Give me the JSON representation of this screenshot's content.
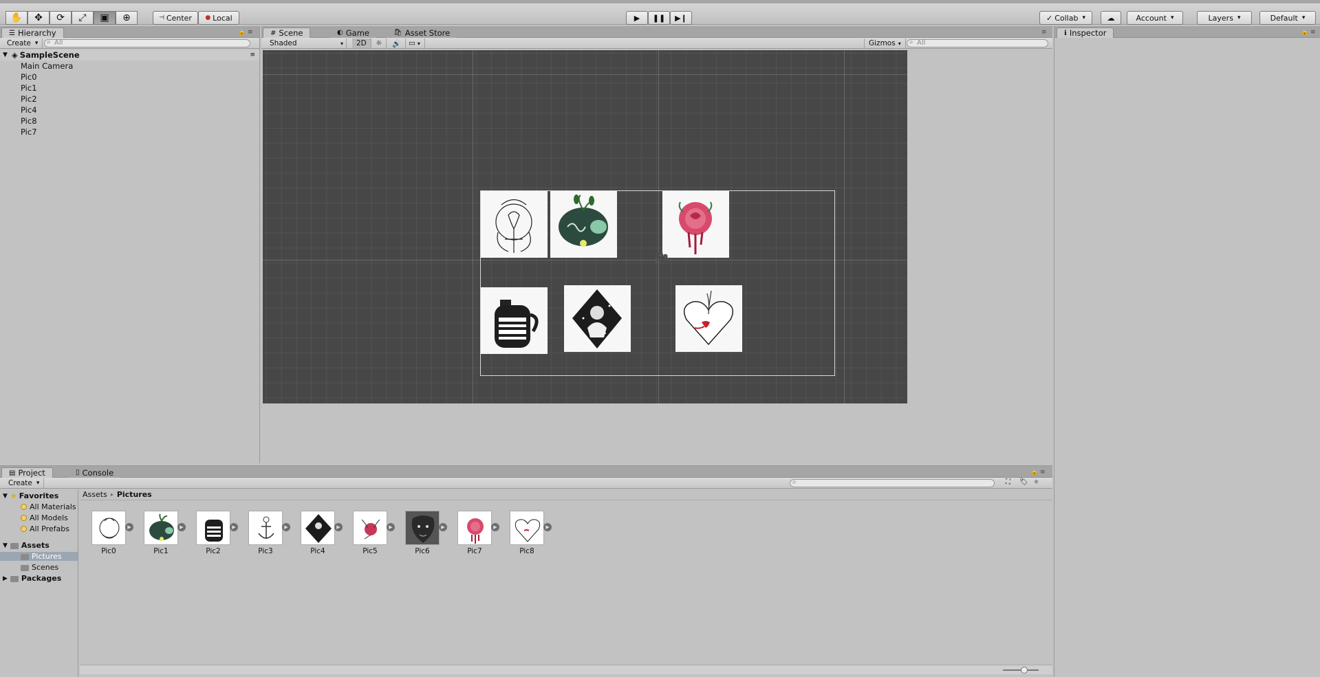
{
  "toolbar": {
    "tools": [
      "hand-tool-icon",
      "move-tool-icon",
      "rotate-tool-icon",
      "scale-tool-icon",
      "rect-tool-icon",
      "transform-tool-icon"
    ],
    "pivot_mode": "Center",
    "pivot_rotation": "Local",
    "collab": "Collab",
    "account": "Account",
    "layers": "Layers",
    "layout": "Default"
  },
  "hierarchy": {
    "tab": "Hierarchy",
    "create": "Create",
    "search_placeholder": "All",
    "scene": "SampleScene",
    "items": [
      "Main Camera",
      "Pic0",
      "Pic1",
      "Pic2",
      "Pic4",
      "Pic8",
      "Pic7"
    ]
  },
  "scene_tabs": {
    "scene": "Scene",
    "game": "Game",
    "asset_store": "Asset Store"
  },
  "scene_toolbar": {
    "shading": "Shaded",
    "mode_2d": "2D",
    "gizmos": "Gizmos",
    "search_placeholder": "All"
  },
  "inspector": {
    "tab": "Inspector"
  },
  "project": {
    "tab_project": "Project",
    "tab_console": "Console",
    "create": "Create",
    "favorites": "Favorites",
    "favorite_items": [
      "All Materials",
      "All Models",
      "All Prefabs"
    ],
    "assets": "Assets",
    "asset_folders": [
      "Pictures",
      "Scenes"
    ],
    "packages": "Packages",
    "breadcrumb_root": "Assets",
    "breadcrumb_current": "Pictures",
    "assets_grid": [
      "Pic0",
      "Pic1",
      "Pic2",
      "Pic3",
      "Pic4",
      "Pic5",
      "Pic6",
      "Pic7",
      "Pic8"
    ]
  }
}
